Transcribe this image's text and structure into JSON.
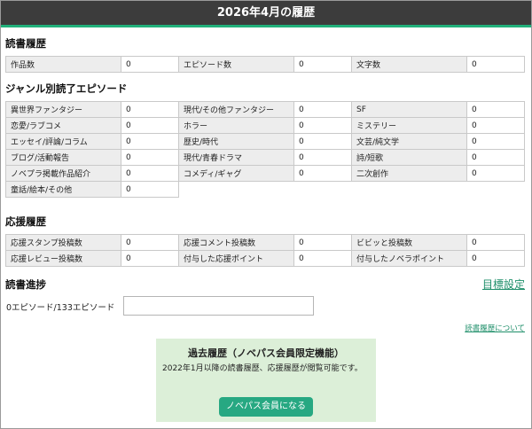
{
  "header": {
    "title": "2026年4月の履歴"
  },
  "reading_history": {
    "title": "読書履歴",
    "rows": [
      [
        {
          "label": "作品数",
          "value": "0"
        },
        {
          "label": "エピソード数",
          "value": "0"
        },
        {
          "label": "文字数",
          "value": "0"
        }
      ]
    ]
  },
  "genre_history": {
    "title": "ジャンル別読了エピソード",
    "rows": [
      [
        {
          "label": "異世界ファンタジー",
          "value": "0"
        },
        {
          "label": "現代/その他ファンタジー",
          "value": "0"
        },
        {
          "label": "SF",
          "value": "0"
        }
      ],
      [
        {
          "label": "恋愛/ラブコメ",
          "value": "0"
        },
        {
          "label": "ホラー",
          "value": "0"
        },
        {
          "label": "ミステリー",
          "value": "0"
        }
      ],
      [
        {
          "label": "エッセイ/評論/コラム",
          "value": "0"
        },
        {
          "label": "歴史/時代",
          "value": "0"
        },
        {
          "label": "文芸/純文学",
          "value": "0"
        }
      ],
      [
        {
          "label": "ブログ/活動報告",
          "value": "0"
        },
        {
          "label": "現代/青春ドラマ",
          "value": "0"
        },
        {
          "label": "詩/短歌",
          "value": "0"
        }
      ],
      [
        {
          "label": "ノベプラ掲載作品紹介",
          "value": "0"
        },
        {
          "label": "コメディ/ギャグ",
          "value": "0"
        },
        {
          "label": "二次創作",
          "value": "0"
        }
      ],
      [
        {
          "label": "童話/絵本/その他",
          "value": "0"
        }
      ]
    ]
  },
  "support_history": {
    "title": "応援履歴",
    "rows": [
      [
        {
          "label": "応援スタンプ投稿数",
          "value": "0"
        },
        {
          "label": "応援コメント投稿数",
          "value": "0"
        },
        {
          "label": "ビビッと投稿数",
          "value": "0"
        }
      ],
      [
        {
          "label": "応援レビュー投稿数",
          "value": "0"
        },
        {
          "label": "付与した応援ポイント",
          "value": "0"
        },
        {
          "label": "付与したノベラポイント",
          "value": "0"
        }
      ]
    ]
  },
  "progress": {
    "title": "読書進捗",
    "goal_link": "目標設定",
    "text": "0エピソード/133エピソード",
    "about_link": "読書履歴について"
  },
  "promo": {
    "title": "過去履歴（ノベパス会員限定機能）",
    "text": "2022年1月以降の読書履歴、応援履歴が閲覧可能です。",
    "button": "ノベパス会員になる"
  },
  "colors": {
    "header_bg": "#3c3c3c",
    "accent": "#21b07a",
    "promo_bg": "#dcefd8",
    "button": "#27a882",
    "link": "#1f8f6a"
  }
}
